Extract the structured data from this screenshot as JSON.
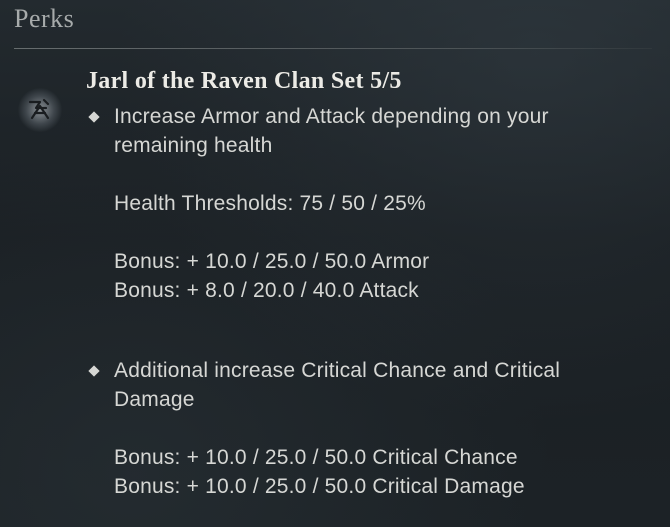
{
  "header": {
    "title": "Perks"
  },
  "perk": {
    "icon": "raven-clan-rune-icon",
    "set_title": "Jarl of the Raven Clan Set 5/5",
    "entries": [
      {
        "description_line1": "Increase Armor and Attack depending on your",
        "description_line2": "remaining health",
        "thresholds": "Health Thresholds: 75 / 50 / 25%",
        "bonus1": "Bonus: + 10.0 / 25.0 / 50.0 Armor",
        "bonus2": "Bonus: + 8.0 / 20.0 / 40.0 Attack"
      },
      {
        "description_line1": "Additional increase Critical Chance and Critical",
        "description_line2": "Damage",
        "bonus1": "Bonus: + 10.0 / 25.0 / 50.0 Critical Chance",
        "bonus2": "Bonus: + 10.0 / 25.0 / 50.0 Critical Damage"
      }
    ]
  },
  "colors": {
    "background": "#1b2024",
    "header_text": "#a7abab",
    "title_text": "#ecebe6",
    "body_text": "#d6d7d4"
  }
}
